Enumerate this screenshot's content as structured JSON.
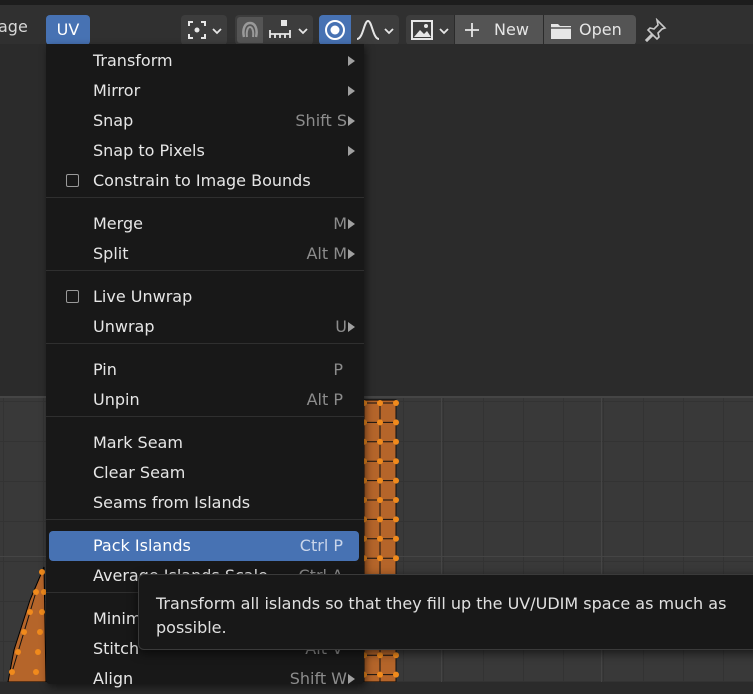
{
  "header": {
    "partial_label": "age",
    "uv_menu_label": "UV",
    "new_label": "New",
    "open_label": "Open"
  },
  "menu": {
    "items": [
      {
        "label": "Transform",
        "shortcut": "",
        "submenu": true
      },
      {
        "label": "Mirror",
        "shortcut": "",
        "submenu": true
      },
      {
        "label": "Snap",
        "shortcut": "Shift S",
        "submenu": true
      },
      {
        "label": "Snap to Pixels",
        "shortcut": "",
        "submenu": true
      },
      {
        "label": "Constrain to Image Bounds",
        "shortcut": "",
        "checkbox": true,
        "checked": false
      },
      {
        "label": "Merge",
        "shortcut": "M",
        "submenu": true
      },
      {
        "label": "Split",
        "shortcut": "Alt M",
        "submenu": true
      },
      {
        "label": "Live Unwrap",
        "shortcut": "",
        "checkbox": true,
        "checked": false
      },
      {
        "label": "Unwrap",
        "shortcut": "U",
        "submenu": true
      },
      {
        "label": "Pin",
        "shortcut": "P"
      },
      {
        "label": "Unpin",
        "shortcut": "Alt P"
      },
      {
        "label": "Mark Seam",
        "shortcut": ""
      },
      {
        "label": "Clear Seam",
        "shortcut": ""
      },
      {
        "label": "Seams from Islands",
        "shortcut": ""
      },
      {
        "label": "Pack Islands",
        "shortcut": "Ctrl P",
        "highlighted": true
      },
      {
        "label": "Average Islands Scale",
        "shortcut": "Ctrl A"
      },
      {
        "label": "Minimize Stretch",
        "shortcut": ""
      },
      {
        "label": "Stitch",
        "shortcut": "Alt V"
      },
      {
        "label": "Align",
        "shortcut": "Shift W",
        "submenu": true
      }
    ]
  },
  "tooltip": {
    "text": "Transform all islands so that they fill up the UV/UDIM space as much as possible."
  },
  "colors": {
    "accent": "#4772b3",
    "menu_bg": "#181818",
    "uv_orange": "#f08a1c",
    "uv_face": "#b5652a"
  }
}
